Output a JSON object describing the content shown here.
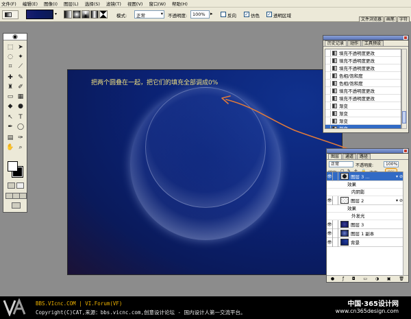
{
  "menu": [
    "文件(F)",
    "编辑(E)",
    "图像(I)",
    "图层(L)",
    "选择(S)",
    "滤镜(T)",
    "视图(V)",
    "窗口(W)",
    "帮助(H)"
  ],
  "options": {
    "mode_label": "模式:",
    "mode_value": "正常",
    "opacity_label": "不透明度:",
    "opacity_value": "100%",
    "reverse_label": "反向",
    "dither_label": "仿色",
    "transparency_label": "透明区域",
    "dither_checked": true,
    "transparency_checked": true
  },
  "dock_tabs": [
    "文件浏览器",
    "画笔",
    "字符"
  ],
  "canvas": {
    "caption": "把两个圆叠在一起，把它们的填充全部调成0%",
    "accent": "#e07a3a"
  },
  "history": {
    "tabs": [
      "历史记录",
      "动作",
      "工具预设"
    ],
    "items": [
      {
        "label": "填充不透明度更改"
      },
      {
        "label": "填充不透明度更改"
      },
      {
        "label": "填充不透明度更改"
      },
      {
        "label": "色相/饱和度"
      },
      {
        "label": "色相/饱和度"
      },
      {
        "label": "填充不透明度更改"
      },
      {
        "label": "填充不透明度更改"
      },
      {
        "label": "渐变"
      },
      {
        "label": "渐变"
      },
      {
        "label": "渐变"
      },
      {
        "label": "渐变",
        "selected": true
      }
    ]
  },
  "layers": {
    "tabs": [
      "图层",
      "通道",
      "路径"
    ],
    "blend_mode": "正常",
    "opacity_label": "不透明度:",
    "opacity_value": "100%",
    "lock_label": "锁定:",
    "fill_label": "填充:",
    "fill_value": "0%",
    "effects_label": "效果",
    "inner_shadow": "内阴影",
    "outer_glow": "外发光",
    "items": [
      {
        "name": "图层 3 ...",
        "selected": true,
        "fx": true
      },
      {
        "name": "图层 2",
        "fx": true
      },
      {
        "name": "图层 3"
      },
      {
        "name": "图层 1 副本"
      },
      {
        "name": "背景"
      }
    ]
  },
  "footer": {
    "line1": "BBS.VIcnc.COM | VI.Forum(VF)",
    "line2": "Copyright(C)CAT,来源：bbs.vicnc.com,创意设计论坛 - 国内设计人第一交流平台。",
    "watermark_cn": "中国·365设计网",
    "watermark_url": "www.cn365design.com"
  }
}
